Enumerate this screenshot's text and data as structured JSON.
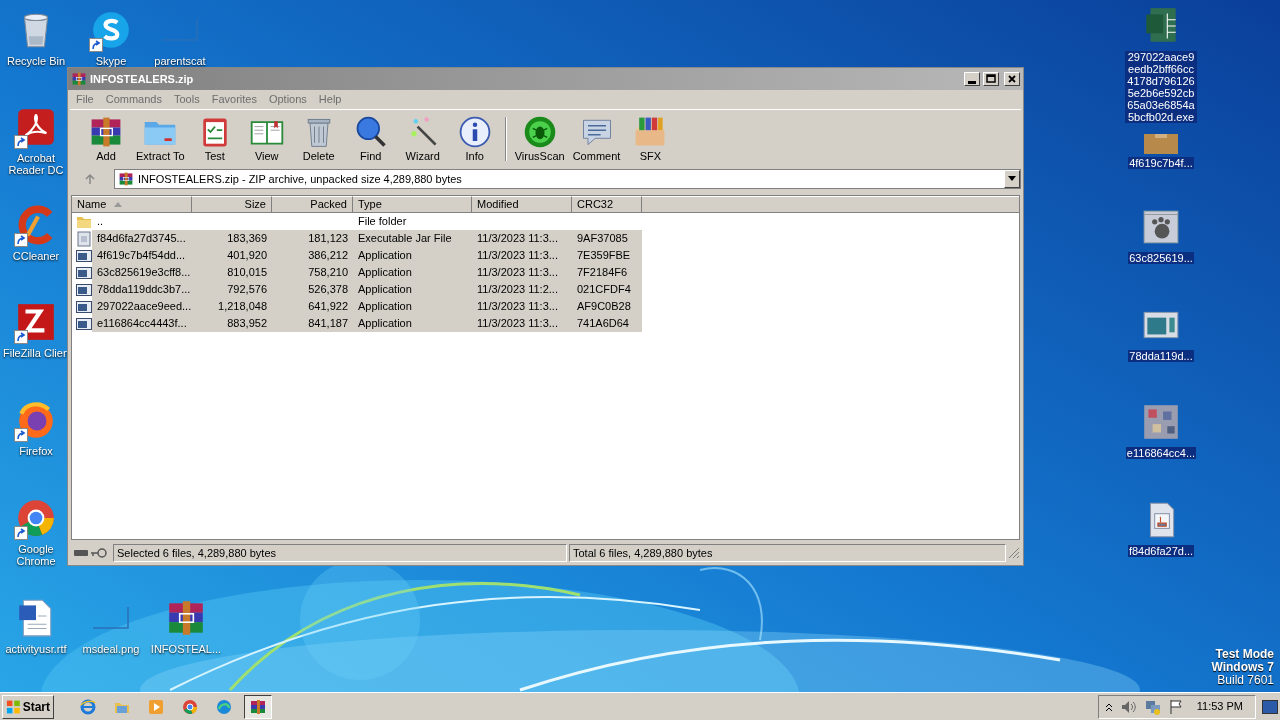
{
  "desktop_icons": [
    {
      "label": "Recycle Bin",
      "kind": "bin",
      "shortcut": false,
      "selected": false
    },
    {
      "label": "Skype",
      "kind": "skype",
      "shortcut": true,
      "selected": false
    },
    {
      "label": "parentscat",
      "kind": "blank",
      "shortcut": false,
      "selected": false
    },
    {
      "label": "Acrobat Reader DC",
      "kind": "acrobat",
      "shortcut": true,
      "selected": false
    },
    {
      "label": "CCleaner",
      "kind": "ccleaner",
      "shortcut": true,
      "selected": false
    },
    {
      "label": "FileZilla Clien",
      "kind": "filezilla",
      "shortcut": true,
      "selected": false
    },
    {
      "label": "Firefox",
      "kind": "firefox",
      "shortcut": true,
      "selected": false
    },
    {
      "label": "Google Chrome",
      "kind": "chrome",
      "shortcut": true,
      "selected": false
    },
    {
      "label": "activityusr.rtf",
      "kind": "word",
      "shortcut": false,
      "selected": false
    },
    {
      "label": "msdeal.png",
      "kind": "blank",
      "shortcut": false,
      "selected": false
    },
    {
      "label": "INFOSTEAL...",
      "kind": "winrar",
      "shortcut": false,
      "selected": false
    },
    {
      "label": "297022aace9eedb2bff66cc4178d7961265e2b6e592cb65a03e6854a5bcfb02d.exe",
      "kind": "excel",
      "shortcut": false,
      "selected": true
    },
    {
      "label": "4f619c7b4f...",
      "kind": "package",
      "shortcut": false,
      "selected": true
    },
    {
      "label": "63c825619...",
      "kind": "paw",
      "shortcut": false,
      "selected": true
    },
    {
      "label": "78dda119d...",
      "kind": "window",
      "shortcut": false,
      "selected": true
    },
    {
      "label": "e116864cc4...",
      "kind": "mosaic",
      "shortcut": false,
      "selected": true
    },
    {
      "label": "f84d6fa27d...",
      "kind": "java",
      "shortcut": false,
      "selected": true
    }
  ],
  "window": {
    "title": "INFOSTEALERS.zip",
    "menu": [
      "File",
      "Commands",
      "Tools",
      "Favorites",
      "Options",
      "Help"
    ],
    "toolbar": [
      {
        "label": "Add",
        "kind": "archive",
        "separator_before": false
      },
      {
        "label": "Extract To",
        "kind": "folder",
        "separator_before": false
      },
      {
        "label": "Test",
        "kind": "clipboard",
        "separator_before": false
      },
      {
        "label": "View",
        "kind": "book",
        "separator_before": false
      },
      {
        "label": "Delete",
        "kind": "trash",
        "separator_before": false
      },
      {
        "label": "Find",
        "kind": "magnifier",
        "separator_before": false
      },
      {
        "label": "Wizard",
        "kind": "wand",
        "separator_before": false
      },
      {
        "label": "Info",
        "kind": "info",
        "separator_before": false
      },
      {
        "label": "VirusScan",
        "kind": "bug",
        "separator_before": true
      },
      {
        "label": "Comment",
        "kind": "bubble",
        "separator_before": false
      },
      {
        "label": "SFX",
        "kind": "box",
        "separator_before": false
      }
    ],
    "address": "INFOSTEALERS.zip - ZIP archive, unpacked size 4,289,880 bytes",
    "table": {
      "columns": [
        {
          "label": "Name",
          "sorted": true
        },
        {
          "label": "Size",
          "sorted": false
        },
        {
          "label": "Packed",
          "sorted": false
        },
        {
          "label": "Type",
          "sorted": false
        },
        {
          "label": "Modified",
          "sorted": false
        },
        {
          "label": "CRC32",
          "sorted": false
        }
      ],
      "rows": [
        {
          "kind": "folder",
          "name": "..",
          "type": "File folder",
          "selected": false
        },
        {
          "kind": "jar",
          "name": "f84d6fa27d3745...",
          "size": "183,369",
          "packed": "181,123",
          "type": "Executable Jar File",
          "modified": "11/3/2023 11:3...",
          "crc32": "9AF37085",
          "selected": true
        },
        {
          "kind": "app",
          "name": "4f619c7b4f54dd...",
          "size": "401,920",
          "packed": "386,212",
          "type": "Application",
          "modified": "11/3/2023 11:3...",
          "crc32": "7E359FBE",
          "selected": true
        },
        {
          "kind": "app",
          "name": "63c825619e3cff8...",
          "size": "810,015",
          "packed": "758,210",
          "type": "Application",
          "modified": "11/3/2023 11:3...",
          "crc32": "7F2184F6",
          "selected": true
        },
        {
          "kind": "app",
          "name": "78dda119ddc3b7...",
          "size": "792,576",
          "packed": "526,378",
          "type": "Application",
          "modified": "11/3/2023 11:2...",
          "crc32": "021CFDF4",
          "selected": true
        },
        {
          "kind": "app",
          "name": "297022aace9eed...",
          "size": "1,218,048",
          "packed": "641,922",
          "type": "Application",
          "modified": "11/3/2023 11:3...",
          "crc32": "AF9C0B28",
          "selected": true
        },
        {
          "kind": "app",
          "name": "e116864cc4443f...",
          "size": "883,952",
          "packed": "841,187",
          "type": "Application",
          "modified": "11/3/2023 11:3...",
          "crc32": "741A6D64",
          "selected": true
        }
      ]
    },
    "status_left": "Selected 6 files, 4,289,880 bytes",
    "status_right": "Total 6 files, 4,289,880 bytes"
  },
  "watermark_system": [
    "Test Mode",
    "Windows 7",
    "Build 7601"
  ],
  "taskbar": {
    "start": "Start",
    "pinned": [
      {
        "kind": "ie",
        "selected": false
      },
      {
        "kind": "explorer",
        "selected": false
      },
      {
        "kind": "media",
        "selected": false
      },
      {
        "kind": "chrome",
        "selected": false
      },
      {
        "kind": "edge",
        "selected": false
      },
      {
        "kind": "winrar",
        "selected": true
      }
    ],
    "clock": "11:53 PM"
  }
}
